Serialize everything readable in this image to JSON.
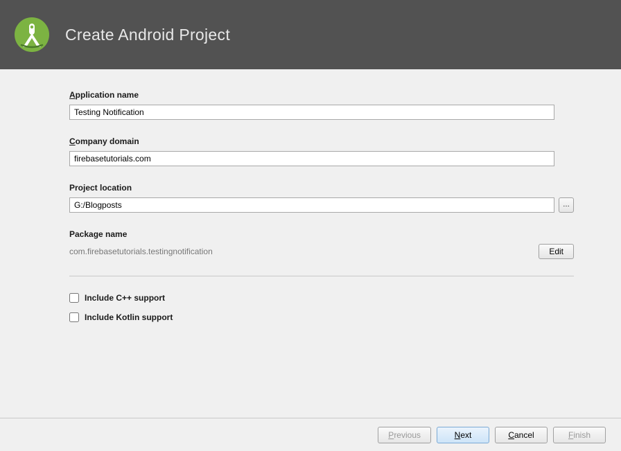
{
  "header": {
    "title": "Create Android Project"
  },
  "fields": {
    "app_name_label": "Application name",
    "app_name_value": "Testing Notification",
    "company_label": "Company domain",
    "company_value": "firebasetutorials.com",
    "location_label": "Project location",
    "location_value": "G:/Blogposts",
    "package_label": "Package name",
    "package_value": "com.firebasetutorials.testingnotification",
    "edit_label": "Edit",
    "cpp_label": "Include C++ support",
    "kotlin_label": "Include Kotlin support"
  },
  "buttons": {
    "previous": "Previous",
    "next": "Next",
    "cancel": "Cancel",
    "finish": "Finish"
  }
}
